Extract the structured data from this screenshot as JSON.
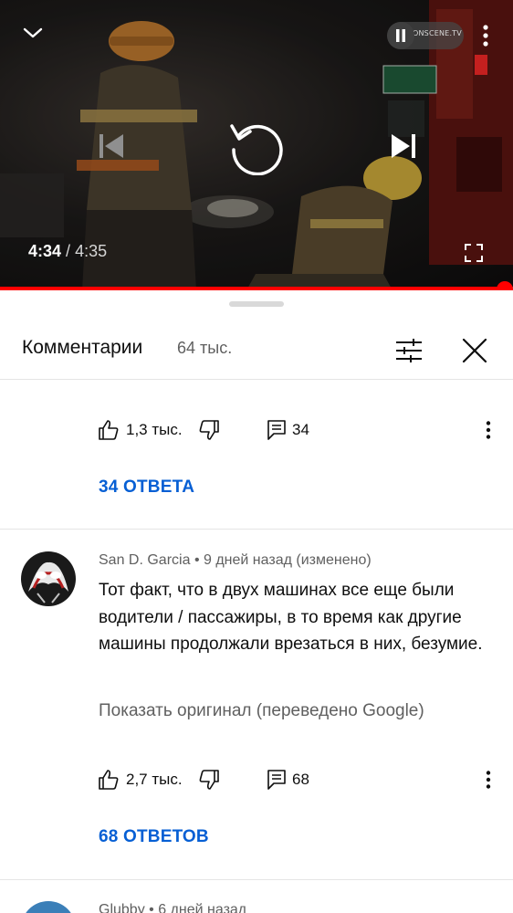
{
  "player": {
    "watermark": "ONSCENE.TV",
    "current_time": "4:34",
    "time_separator": "/",
    "duration": "4:35",
    "progress": 0.996,
    "icons": {
      "collapse": "chevron-down-icon",
      "pause": "pause-icon",
      "more": "more-vert-icon",
      "previous": "skip-previous-icon",
      "replay": "replay-icon",
      "next": "skip-next-icon",
      "fullscreen": "fullscreen-icon"
    },
    "accent_color": "#ff0000"
  },
  "comments_panel": {
    "title": "Комментарии",
    "count": "64 тыс.",
    "icons": {
      "filter": "tune-icon",
      "close": "close-icon"
    }
  },
  "comments": [
    {
      "likes": "1,3 тыс.",
      "replies": "34",
      "replies_link": "34 ОТВЕТА"
    },
    {
      "author": "San D. Garcia",
      "meta_separator": "•",
      "time": "9 дней назад (изменено)",
      "text": "Тот факт, что в двух машинах все еще были водители / пассажиры, в то время как другие машины продолжали врезаться в них, безумие.",
      "translation_link": "Показать оригинал (переведено Google)",
      "likes": "2,7 тыс.",
      "replies": "68",
      "replies_link": "68 ОТВЕТОВ"
    },
    {
      "author": "Glubby",
      "meta_separator": "•",
      "time": "6 дней назад"
    }
  ],
  "colors": {
    "link_blue": "#065fd4",
    "secondary_text": "#606060",
    "divider": "#e5e5e5"
  }
}
